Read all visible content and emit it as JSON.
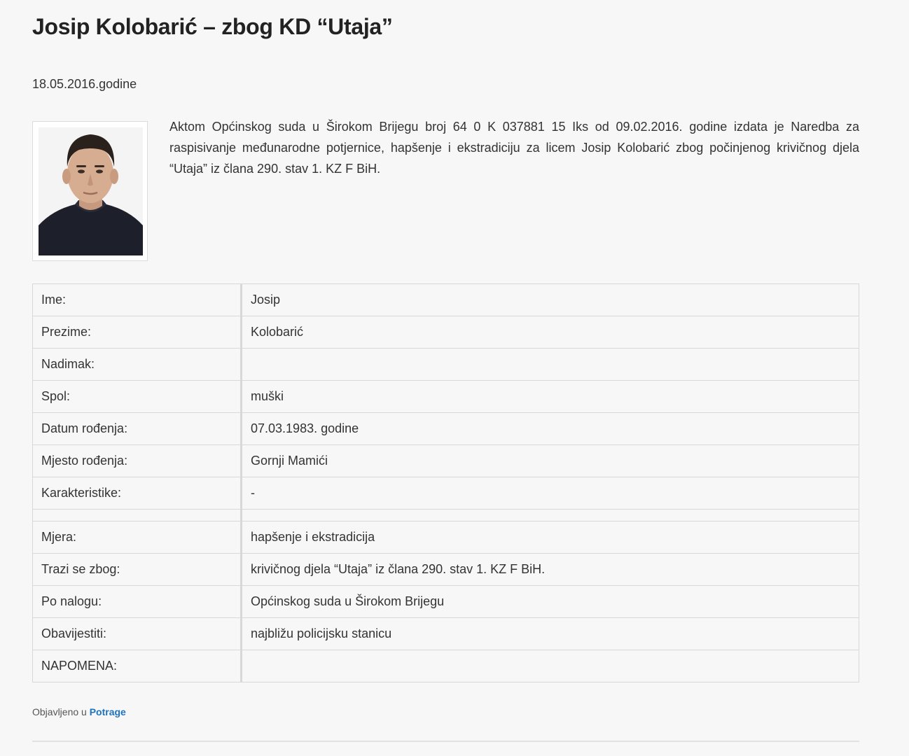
{
  "article": {
    "title": "Josip Kolobarić – zbog KD “Utaja”",
    "date": "18.05.2016.godine",
    "intro": "Aktom Općinskog suda u Širokom Brijegu broj 64 0 K 037881 15 Iks od 09.02.2016. godine izdata je Naredba za raspisivanje međunarodne potjernice, hapšenje i ekstradiciju za licem Josip Kolobarić zbog počinjenog krivičnog djela “Utaja” iz člana 290. stav 1. KZ F BiH."
  },
  "details": {
    "rows": [
      {
        "label": "Ime:",
        "value": "Josip"
      },
      {
        "label": "Prezime:",
        "value": "Kolobarić"
      },
      {
        "label": "Nadimak:",
        "value": ""
      },
      {
        "label": "Spol:",
        "value": "muški"
      },
      {
        "label": "Datum rođenja:",
        "value": "07.03.1983. godine"
      },
      {
        "label": "Mjesto rođenja:",
        "value": "Gornji Mamići"
      },
      {
        "label": "Karakteristike:",
        "value": "-"
      }
    ],
    "rows2": [
      {
        "label": "Mjera:",
        "value": "hapšenje i ekstradicija"
      },
      {
        "label": "Trazi se zbog:",
        "value": "krivičnog djela “Utaja” iz člana 290. stav 1. KZ F BiH."
      },
      {
        "label": "Po nalogu:",
        "value": "Općinskog suda u Širokom Brijegu"
      },
      {
        "label": "Obavijestiti:",
        "value": "najbližu policijsku stanicu"
      },
      {
        "label": "NAPOMENA:",
        "value": ""
      }
    ]
  },
  "footer": {
    "prefix": "Objavljeno u",
    "category": "Potrage",
    "link_color": "#1e73be"
  }
}
